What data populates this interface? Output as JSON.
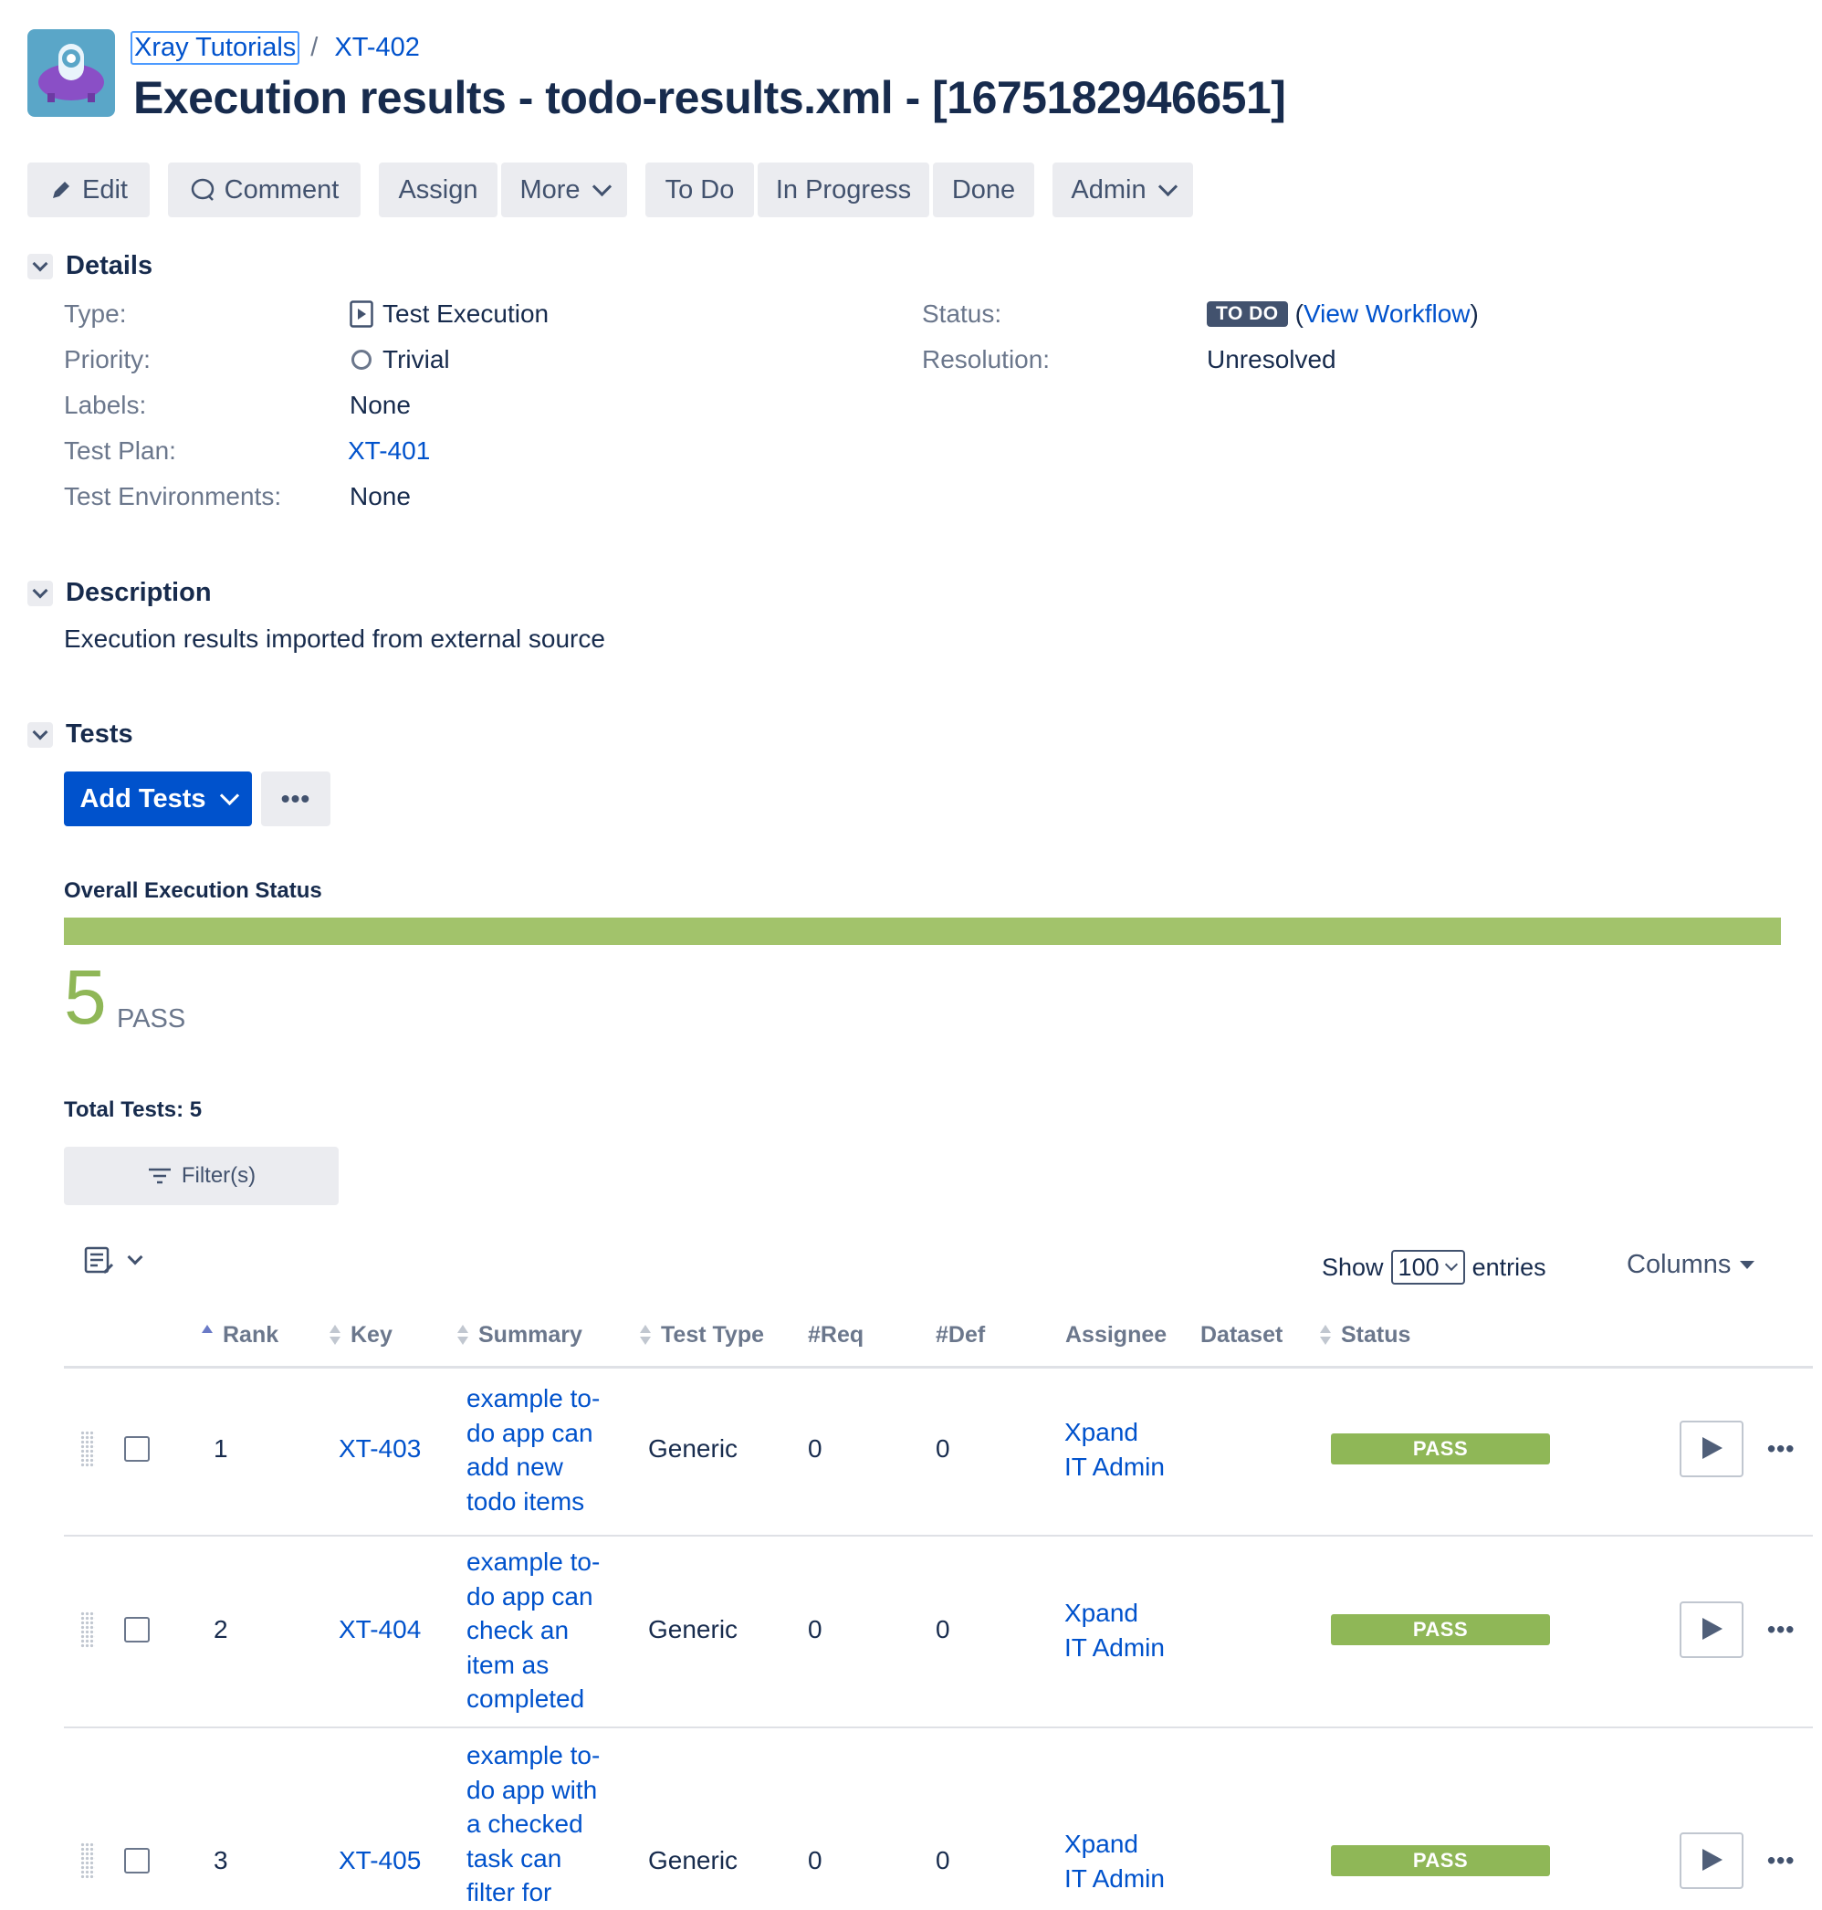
{
  "header": {
    "project_link": "Xray Tutorials",
    "separator": "/",
    "issue_key": "XT-402",
    "title": "Execution results - todo-results.xml - [1675182946651]"
  },
  "toolbar": {
    "edit": "Edit",
    "comment": "Comment",
    "assign": "Assign",
    "more": "More",
    "todo": "To Do",
    "in_progress": "In Progress",
    "done": "Done",
    "admin": "Admin"
  },
  "details": {
    "heading": "Details",
    "type_label": "Type:",
    "type_value": "Test Execution",
    "priority_label": "Priority:",
    "priority_value": "Trivial",
    "labels_label": "Labels:",
    "labels_value": "None",
    "test_plan_label": "Test Plan:",
    "test_plan_value": "XT-401",
    "test_env_label": "Test Environments:",
    "test_env_value": "None",
    "status_label": "Status:",
    "status_value": "TO DO",
    "view_workflow_open": "(",
    "view_workflow": "View Workflow",
    "view_workflow_close": ")",
    "resolution_label": "Resolution:",
    "resolution_value": "Unresolved"
  },
  "description": {
    "heading": "Description",
    "text": "Execution results imported from external source"
  },
  "tests": {
    "heading": "Tests",
    "add_tests": "Add Tests",
    "more_actions": "•••",
    "overall_status_title": "Overall Execution Status",
    "progress_pass_fraction": 1.0,
    "pass_count": "5",
    "pass_label": "PASS",
    "total_tests": "Total Tests: 5",
    "filter_button": "Filter(s)",
    "show_label": "Show",
    "show_value": "100",
    "entries_label": "entries",
    "columns_button": "Columns",
    "columns": [
      "Rank",
      "Key",
      "Summary",
      "Test Type",
      "#Req",
      "#Def",
      "Assignee",
      "Dataset",
      "Status"
    ],
    "rows": [
      {
        "rank": "1",
        "key": "XT-403",
        "summary": [
          "example to-",
          "do app can",
          "add new",
          "todo items"
        ],
        "test_type": "Generic",
        "req": "0",
        "def": "0",
        "assignee": [
          "Xpand",
          "IT Admin"
        ],
        "dataset": "",
        "status": "PASS"
      },
      {
        "rank": "2",
        "key": "XT-404",
        "summary": [
          "example to-",
          "do app can",
          "check an",
          "item as",
          "completed"
        ],
        "test_type": "Generic",
        "req": "0",
        "def": "0",
        "assignee": [
          "Xpand",
          "IT Admin"
        ],
        "dataset": "",
        "status": "PASS"
      },
      {
        "rank": "3",
        "key": "XT-405",
        "summary": [
          "example to-",
          "do app with",
          "a checked",
          "task can",
          "filter for"
        ],
        "test_type": "Generic",
        "req": "0",
        "def": "0",
        "assignee": [
          "Xpand",
          "IT Admin"
        ],
        "dataset": "",
        "status": "PASS"
      }
    ]
  },
  "colors": {
    "link": "#0052cc",
    "primary_button": "#0052cc",
    "pass": "#8fb757",
    "progress_pass": "#a2c36b",
    "todo_lozenge": "#42526e"
  },
  "icons": {
    "project_avatar": "xray-robot-logo",
    "edit": "pencil-icon",
    "comment": "comment-bubble-icon",
    "type": "test-execution-icon",
    "priority": "trivial-priority-icon",
    "filter": "filter-lines-icon",
    "row_actions": "ellipsis-icon",
    "run": "play-icon"
  }
}
